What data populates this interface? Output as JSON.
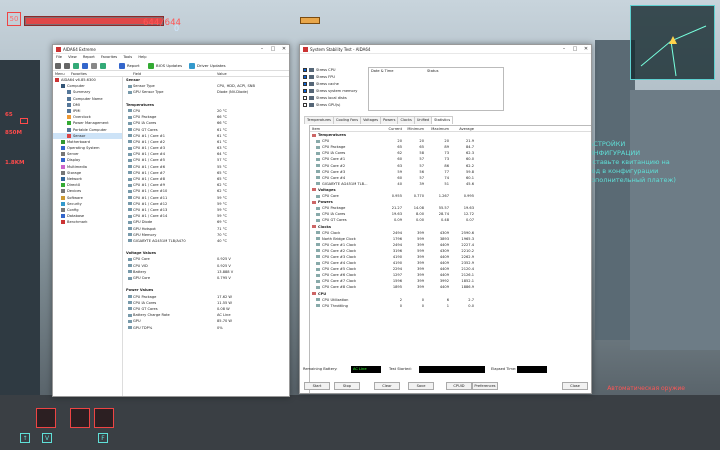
{
  "hud": {
    "level": "50",
    "health_text": "644/644",
    "health_fraction": 1.0,
    "top_drop": "0",
    "stats": [
      {
        "label": "65"
      },
      {
        "label": "850M"
      },
      {
        "label": "1.8KM"
      }
    ],
    "objective_lines": [
      "НАСТРОЙКИ",
      "КОНФИГУРАЦИИ",
      "доставьте квитанцию на",
      "вход в конфигурации",
      "(дополнительный платеж)"
    ],
    "hotkeys": [
      "↑",
      "V",
      "F"
    ],
    "ammo": "Автоматическая оружие"
  },
  "aida": {
    "title": "AIDA64 Extreme",
    "menu": [
      "File",
      "View",
      "Report",
      "Favorites",
      "Tools",
      "Help"
    ],
    "toolbar": {
      "report": "Report",
      "bios": "BIOS Updates",
      "driver": "Driver Updates"
    },
    "tree_header": {
      "menu": "Menu",
      "favorites": "Favorites"
    },
    "col_field": "Field",
    "col_value": "Value",
    "tree": [
      {
        "label": "AIDA64 v6.85.6300",
        "indent": 0,
        "color": "#c33"
      },
      {
        "label": "Computer",
        "indent": 1,
        "color": "#357"
      },
      {
        "label": "Summary",
        "indent": 2,
        "color": "#579"
      },
      {
        "label": "Computer Name",
        "indent": 2,
        "color": "#579"
      },
      {
        "label": "DMI",
        "indent": 2,
        "color": "#579"
      },
      {
        "label": "IPMI",
        "indent": 2,
        "color": "#579"
      },
      {
        "label": "Overclock",
        "indent": 2,
        "color": "#e93"
      },
      {
        "label": "Power Management",
        "indent": 2,
        "color": "#3a3"
      },
      {
        "label": "Portable Computer",
        "indent": 2,
        "color": "#579"
      },
      {
        "label": "Sensor",
        "indent": 2,
        "color": "#d44"
      },
      {
        "label": "Motherboard",
        "indent": 1,
        "color": "#393"
      },
      {
        "label": "Operating System",
        "indent": 1,
        "color": "#36c"
      },
      {
        "label": "Server",
        "indent": 1,
        "color": "#777"
      },
      {
        "label": "Display",
        "indent": 1,
        "color": "#36c"
      },
      {
        "label": "Multimedia",
        "indent": 1,
        "color": "#c6c"
      },
      {
        "label": "Storage",
        "indent": 1,
        "color": "#777"
      },
      {
        "label": "Network",
        "indent": 1,
        "color": "#369"
      },
      {
        "label": "DirectX",
        "indent": 1,
        "color": "#3a3"
      },
      {
        "label": "Devices",
        "indent": 1,
        "color": "#777"
      },
      {
        "label": "Software",
        "indent": 1,
        "color": "#c93"
      },
      {
        "label": "Security",
        "indent": 1,
        "color": "#39c"
      },
      {
        "label": "Config",
        "indent": 1,
        "color": "#777"
      },
      {
        "label": "Database",
        "indent": 1,
        "color": "#36c"
      },
      {
        "label": "Benchmark",
        "indent": 1,
        "color": "#c33"
      }
    ],
    "rows": [
      {
        "f": "Sensor",
        "v": "",
        "sec": true
      },
      {
        "f": "Sensor Type",
        "v": "CPU, HDD, ACPI, SNB"
      },
      {
        "f": "GPU Sensor Type",
        "v": "Diode  (NV-Diode)"
      },
      {
        "f": "",
        "v": "",
        "blank": true
      },
      {
        "f": "Temperatures",
        "v": "",
        "sec": true
      },
      {
        "f": "CPU",
        "v": "20 °C"
      },
      {
        "f": "CPU Package",
        "v": "66 °C"
      },
      {
        "f": "CPU IA Cores",
        "v": "66 °C"
      },
      {
        "f": "CPU GT Cores",
        "v": "61 °C"
      },
      {
        "f": "CPU #1 / Core #1",
        "v": "61 °C"
      },
      {
        "f": "CPU #1 / Core #2",
        "v": "61 °C"
      },
      {
        "f": "CPU #1 / Core #3",
        "v": "63 °C"
      },
      {
        "f": "CPU #1 / Core #4",
        "v": "64 °C"
      },
      {
        "f": "CPU #1 / Core #5",
        "v": "57 °C"
      },
      {
        "f": "CPU #1 / Core #6",
        "v": "55 °C"
      },
      {
        "f": "CPU #1 / Core #7",
        "v": "65 °C"
      },
      {
        "f": "CPU #1 / Core #8",
        "v": "65 °C"
      },
      {
        "f": "CPU #1 / Core #9",
        "v": "62 °C"
      },
      {
        "f": "CPU #1 / Core #10",
        "v": "62 °C"
      },
      {
        "f": "CPU #1 / Core #11",
        "v": "59 °C"
      },
      {
        "f": "CPU #1 / Core #12",
        "v": "59 °C"
      },
      {
        "f": "CPU #1 / Core #13",
        "v": "59 °C"
      },
      {
        "f": "CPU #1 / Core #14",
        "v": "59 °C"
      },
      {
        "f": "GPU Diode",
        "v": "69 °C"
      },
      {
        "f": "GPU Hotspot",
        "v": "71 °C"
      },
      {
        "f": "GPU Memory",
        "v": "70 °C"
      },
      {
        "f": "GIGABYTE AG451M TLB/A470",
        "v": "40 °C"
      },
      {
        "f": "",
        "v": "",
        "blank": true
      },
      {
        "f": "Voltage Values",
        "v": "",
        "sec": true
      },
      {
        "f": "CPU Core",
        "v": "0.925 V"
      },
      {
        "f": "CPU VID",
        "v": "0.925 V"
      },
      {
        "f": "Battery",
        "v": "13.888 V"
      },
      {
        "f": "GPU Core",
        "v": "0.795 V"
      },
      {
        "f": "",
        "v": "",
        "blank": true
      },
      {
        "f": "Power Values",
        "v": "",
        "sec": true
      },
      {
        "f": "CPU Package",
        "v": "17.62 W"
      },
      {
        "f": "CPU IA Cores",
        "v": "11.55 W"
      },
      {
        "f": "CPU GT Cores",
        "v": "0.08 W"
      },
      {
        "f": "Battery Charge Rate",
        "v": "AC Line"
      },
      {
        "f": "GPU",
        "v": "85.70 W"
      },
      {
        "f": "GPU TDP%",
        "v": "0%"
      }
    ]
  },
  "sst": {
    "title": "System Stability Test - AIDA64",
    "checks": [
      {
        "label": "Stress CPU",
        "on": true
      },
      {
        "label": "Stress FPU",
        "on": true
      },
      {
        "label": "Stress cache",
        "on": true
      },
      {
        "label": "Stress system memory",
        "on": true
      },
      {
        "label": "Stress local disks",
        "on": false
      },
      {
        "label": "Stress GPU(s)",
        "on": false
      }
    ],
    "log_headers": {
      "date": "Date & Time",
      "status": "Status"
    },
    "tabs": [
      "Temperatures",
      "Cooling Fans",
      "Voltages",
      "Powers",
      "Clocks",
      "Unified",
      "Statistics"
    ],
    "stat_headers": {
      "item": "Item",
      "current": "Current",
      "min": "Minimum",
      "max": "Maximum",
      "avg": "Average"
    },
    "rows": [
      {
        "n": "Temperatures",
        "grp": true
      },
      {
        "n": "CPU",
        "c": "20",
        "mi": "20",
        "ma": "20",
        "av": "21.9"
      },
      {
        "n": "CPU Package",
        "c": "65",
        "mi": "65",
        "ma": "89",
        "av": "84.7"
      },
      {
        "n": "CPU IA Cores",
        "c": "62",
        "mi": "58",
        "ma": "73",
        "av": "62.3"
      },
      {
        "n": "CPU Core #1",
        "c": "60",
        "mi": "57",
        "ma": "73",
        "av": "60.0"
      },
      {
        "n": "CPU Core #2",
        "c": "63",
        "mi": "57",
        "ma": "86",
        "av": "62.2"
      },
      {
        "n": "CPU Core #3",
        "c": "59",
        "mi": "56",
        "ma": "77",
        "av": "59.8"
      },
      {
        "n": "CPU Core #4",
        "c": "60",
        "mi": "57",
        "ma": "74",
        "av": "60.1"
      },
      {
        "n": "GIGABYTE AG451M TLB...",
        "c": "40",
        "mi": "39",
        "ma": "51",
        "av": "45.6"
      },
      {
        "n": "Voltages",
        "grp": true
      },
      {
        "n": "CPU Core",
        "c": "0.955",
        "mi": "0.770",
        "ma": "1.267",
        "av": "0.995"
      },
      {
        "n": "Powers",
        "grp": true
      },
      {
        "n": "CPU Package",
        "c": "21.27",
        "mi": "14.08",
        "ma": "55.57",
        "av": "19.63"
      },
      {
        "n": "CPU IA Cores",
        "c": "19.63",
        "mi": "8.00",
        "ma": "28.74",
        "av": "12.72"
      },
      {
        "n": "CPU GT Cores",
        "c": "0.09",
        "mi": "0.00",
        "ma": "0.48",
        "av": "0.07"
      },
      {
        "n": "Clocks",
        "grp": true
      },
      {
        "n": "CPU Clock",
        "c": "2494",
        "mi": "399",
        "ma": "4309",
        "av": "2590.6"
      },
      {
        "n": "North Bridge Clock",
        "c": "1796",
        "mi": "599",
        "ma": "3893",
        "av": "1965.3"
      },
      {
        "n": "CPU Core #1 Clock",
        "c": "2494",
        "mi": "399",
        "ma": "4409",
        "av": "2227.4"
      },
      {
        "n": "CPU Core #2 Clock",
        "c": "3196",
        "mi": "599",
        "ma": "4309",
        "av": "2210.2"
      },
      {
        "n": "CPU Core #3 Clock",
        "c": "4190",
        "mi": "399",
        "ma": "4409",
        "av": "2262.9"
      },
      {
        "n": "CPU Core #4 Clock",
        "c": "4190",
        "mi": "399",
        "ma": "4409",
        "av": "2352.9"
      },
      {
        "n": "CPU Core #5 Clock",
        "c": "2294",
        "mi": "399",
        "ma": "4409",
        "av": "2120.4"
      },
      {
        "n": "CPU Core #6 Clock",
        "c": "1297",
        "mi": "399",
        "ma": "4409",
        "av": "2126.1"
      },
      {
        "n": "CPU Core #7 Clock",
        "c": "1596",
        "mi": "399",
        "ma": "3992",
        "av": "1852.1"
      },
      {
        "n": "CPU Core #8 Clock",
        "c": "1895",
        "mi": "399",
        "ma": "4409",
        "av": "1886.9"
      },
      {
        "n": "CPU",
        "grp": true
      },
      {
        "n": "CPU Utilization",
        "c": "2",
        "mi": "0",
        "ma": "6",
        "av": "2.7"
      },
      {
        "n": "CPU Throttling",
        "c": "0",
        "mi": "0",
        "ma": "1",
        "av": "0.0"
      }
    ],
    "status": {
      "battery_label": "Remaining Battery:",
      "battery_value": "AC Line",
      "started_label": "Test Started:",
      "elapsed_label": "Elapsed Time:"
    },
    "buttons": [
      "Start",
      "Stop",
      "Clear",
      "Save",
      "CPUID",
      "Preferences",
      "Close"
    ]
  }
}
